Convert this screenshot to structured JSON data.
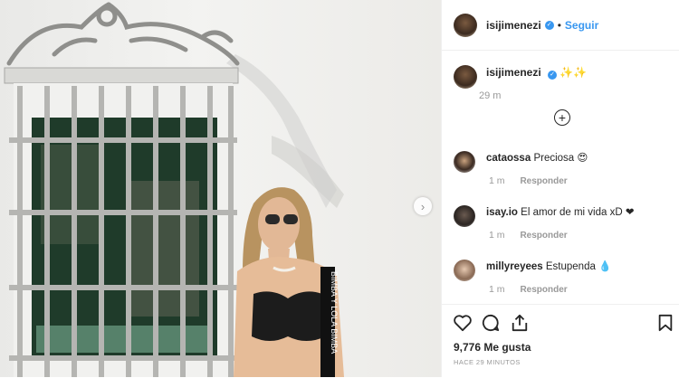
{
  "post": {
    "username": "isijimenezi",
    "follow_label": "Seguir",
    "separator": "•",
    "caption_text": "✨✨",
    "caption_time": "29 m",
    "load_more_symbol": "+",
    "next_arrow": "›"
  },
  "comments": [
    {
      "username": "cataossa",
      "text": "Preciosa 😍",
      "time": "1 m",
      "reply_label": "Responder"
    },
    {
      "username": "isay.io",
      "text": "El amor de mi vida xD ❤",
      "time": "1 m",
      "reply_label": "Responder"
    },
    {
      "username": "millyreyees",
      "text": "Estupenda 💧",
      "time": "1 m",
      "reply_label": "Responder"
    }
  ],
  "actions": {
    "icons": [
      "heart-icon",
      "comment-icon",
      "share-icon",
      "bookmark-icon"
    ],
    "likes_text": "9,776 Me gusta",
    "posted_text": "HACE 29 MINUTOS"
  },
  "colors": {
    "accent": "#3897f0",
    "text": "#262626",
    "muted": "#999999",
    "border": "#efefef"
  }
}
